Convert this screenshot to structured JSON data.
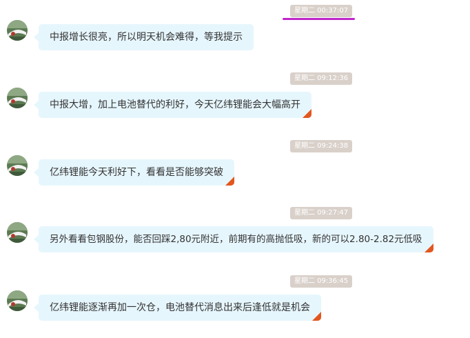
{
  "messages": [
    {
      "time": "星期二 00:37:07",
      "text": "中报增长很亮，所以明天机会难得，等我提示",
      "highlighted": true,
      "flagged": false
    },
    {
      "time": "星期二 09:12:36",
      "text": "中报大增，加上电池替代的利好，今天亿纬锂能会大幅高开",
      "highlighted": false,
      "flagged": true
    },
    {
      "time": "星期二 09:24:38",
      "text": "亿纬锂能今天利好下，看看是否能够突破",
      "highlighted": false,
      "flagged": true
    },
    {
      "time": "星期二 09:27:47",
      "text": "另外看看包钢股份，能否回踩2,80元附近，前期有的高抛低吸，新的可以2.80-2.82元低吸",
      "highlighted": false,
      "flagged": true
    },
    {
      "time": "星期二 09:36:45",
      "text": "亿纬锂能逐渐再加一次仓，电池替代消息出来后逢低就是机会",
      "highlighted": false,
      "flagged": true
    }
  ],
  "colors": {
    "bubble": "#e6f6fd",
    "timestamp_bg": "#d9d0ca",
    "flag": "#e2561f",
    "highlight_underline": "#c026c9"
  },
  "icons": {
    "avatar": "user-avatar-icon",
    "flag": "flag-corner-icon"
  }
}
